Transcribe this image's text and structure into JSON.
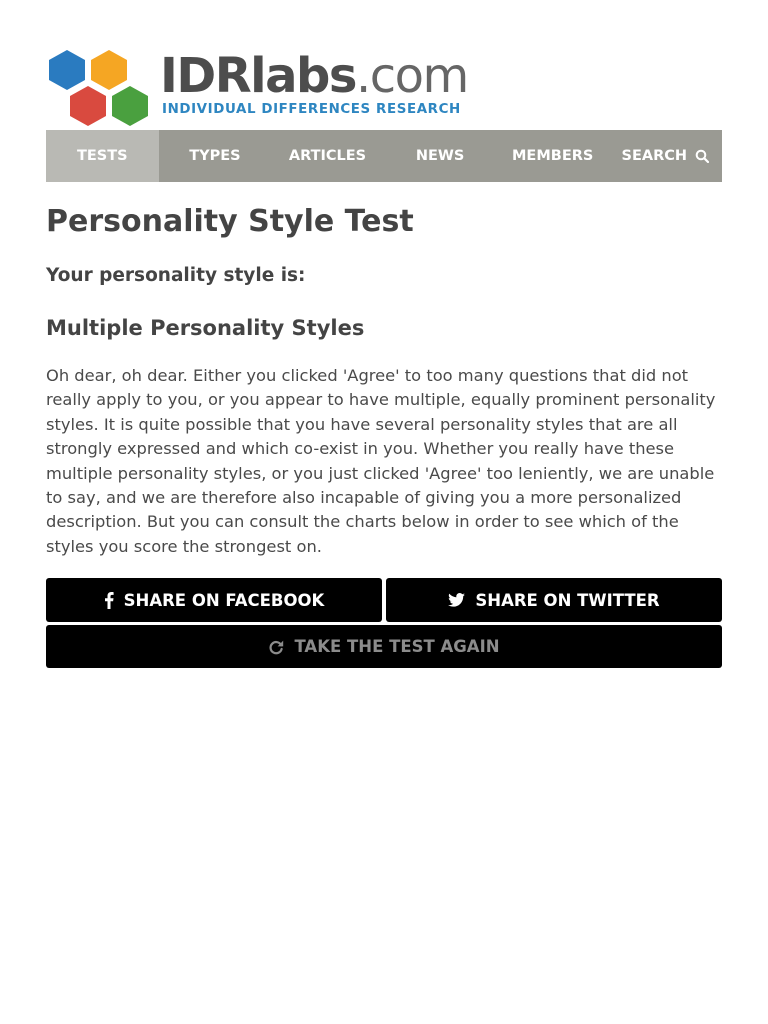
{
  "site": {
    "logo_main": "IDRlabs",
    "logo_suffix": ".com",
    "tagline": "INDIVIDUAL DIFFERENCES RESEARCH",
    "hex_colors": [
      "#2a7bc0",
      "#f5a623",
      "#d94a3f",
      "#4aa03f"
    ]
  },
  "nav": {
    "items": [
      {
        "label": "TESTS",
        "active": true
      },
      {
        "label": "TYPES"
      },
      {
        "label": "ARTICLES"
      },
      {
        "label": "NEWS"
      },
      {
        "label": "MEMBERS"
      },
      {
        "label": "SEARCH",
        "icon": "search-icon"
      }
    ]
  },
  "main": {
    "title": "Personality Style Test",
    "result_label": "Your personality style is:",
    "result_name": "Multiple Personality Styles",
    "description": "Oh dear, oh dear. Either you clicked 'Agree' to too many questions that did not really apply to you, or you appear to have multiple, equally prominent personality styles. It is quite possible that you have several personality styles that are all strongly expressed and which co-exist in you. Whether you really have these multiple personality styles, or you just clicked 'Agree' too leniently, we are unable to say, and we are therefore also incapable of giving you a more personalized description. But you can consult the charts below in order to see which of the styles you score the strongest on."
  },
  "buttons": {
    "facebook": {
      "label": "SHARE ON FACEBOOK",
      "icon": "facebook-icon"
    },
    "twitter": {
      "label": "SHARE ON TWITTER",
      "icon": "twitter-icon"
    },
    "again": {
      "label": "TAKE THE TEST AGAIN",
      "icon": "refresh-icon"
    }
  },
  "colors": {
    "nav_bg": "#9a9a93",
    "nav_active": "#b9b9b4",
    "button_bg": "#000000",
    "tagline": "#2e86c1"
  }
}
